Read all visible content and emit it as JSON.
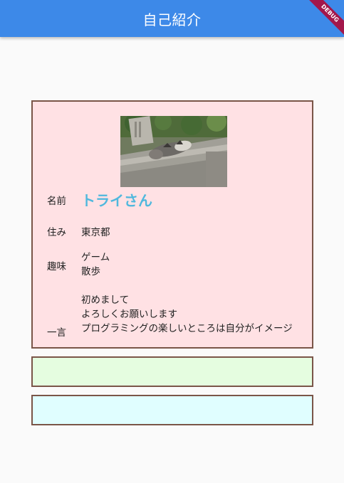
{
  "app_bar": {
    "title": "自己紹介",
    "debug_banner": "DEBUG",
    "color": "#3d89e8"
  },
  "profile": {
    "photo": {
      "icon": "cat-photo"
    },
    "name": {
      "label": "名前",
      "value": "トライさん",
      "value_color": "#4fb8dd"
    },
    "residence": {
      "label": "住み",
      "value": "東京都"
    },
    "hobby": {
      "label": "趣味",
      "values": [
        "ゲーム",
        "散歩"
      ]
    },
    "comment": {
      "label": "一言",
      "values": [
        "初めまして",
        "よろしくお願いします",
        "プログラミングの楽しいところは自分がイメージ"
      ]
    },
    "background": "#ffe1e4"
  },
  "cards": {
    "green_background": "#e5fde0",
    "cyan_background": "#e0feff",
    "border_color": "#7a5548"
  }
}
